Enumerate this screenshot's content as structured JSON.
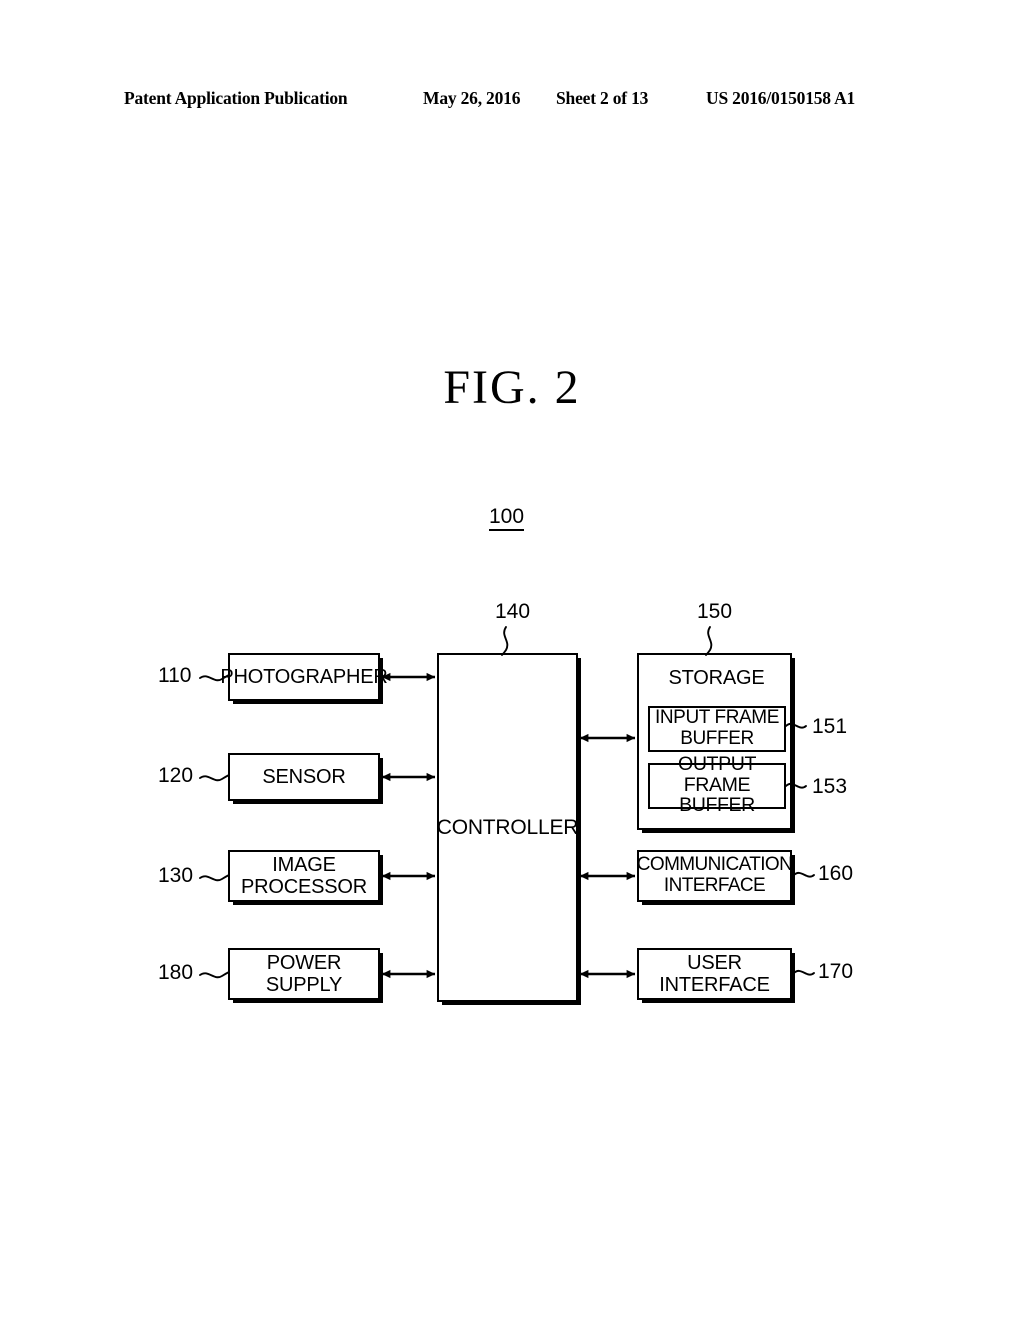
{
  "header": {
    "publication": "Patent Application Publication",
    "date": "May 26, 2016",
    "sheet": "Sheet 2 of 13",
    "patent_number": "US 2016/0150158 A1"
  },
  "figure": {
    "title": "FIG.  2",
    "system_ref": "100"
  },
  "blocks": {
    "photographer": {
      "label": "PHOTOGRAPHER",
      "ref": "110"
    },
    "sensor": {
      "label": "SENSOR",
      "ref": "120"
    },
    "image_processor": {
      "label": "IMAGE\nPROCESSOR",
      "ref": "130"
    },
    "power_supply": {
      "label": "POWER\nSUPPLY",
      "ref": "180"
    },
    "controller": {
      "label": "CONTROLLER",
      "ref": "140"
    },
    "storage": {
      "label": "STORAGE",
      "ref": "150"
    },
    "input_frame_buffer": {
      "label": "INPUT FRAME\nBUFFER",
      "ref": "151"
    },
    "output_frame_buffer": {
      "label": "OUTPUT FRAME\nBUFFER",
      "ref": "153"
    },
    "communication_interface": {
      "label": "COMMUNICATION\nINTERFACE",
      "ref": "160"
    },
    "user_interface": {
      "label": "USER\nINTERFACE",
      "ref": "170"
    }
  },
  "connections": [
    {
      "name": "photographer-controller",
      "type": "bidirectional"
    },
    {
      "name": "sensor-controller",
      "type": "bidirectional"
    },
    {
      "name": "image-processor-controller",
      "type": "bidirectional"
    },
    {
      "name": "power-supply-controller",
      "type": "bidirectional"
    },
    {
      "name": "controller-storage",
      "type": "bidirectional"
    },
    {
      "name": "controller-communication-interface",
      "type": "bidirectional"
    },
    {
      "name": "controller-user-interface",
      "type": "bidirectional"
    }
  ],
  "colors": {
    "ink": "#000000",
    "page": "#ffffff"
  }
}
